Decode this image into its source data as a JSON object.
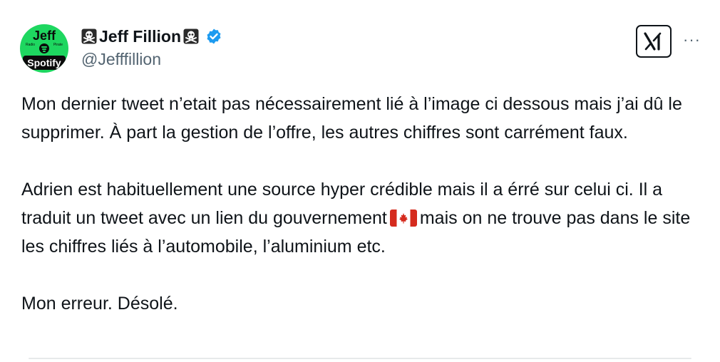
{
  "tweet": {
    "author": {
      "display_name": "Jeff Fillion",
      "handle": "@Jefffillion",
      "avatar": {
        "top_text": "Jeff",
        "small_left": "Radio",
        "small_right": "Pirate",
        "bottom_text": "Spotify"
      },
      "verified": true,
      "name_icons": [
        "skull-crossbones-icon",
        "skull-crossbones-icon"
      ]
    },
    "header": {
      "platform_logo": "x-logo-icon",
      "more_label": "···"
    },
    "text": {
      "paragraph1": "Mon dernier tweet n’etait pas nécessairement lié à l’image ci dessous mais j’ai dû le supprimer. À part la gestion de l’offre, les autres chiffres sont carrément faux.",
      "paragraph2_a": "Adrien est habituellement une source hyper crédible mais il a érré sur celui ci. Il a traduit un tweet avec un lien du gouvernement",
      "paragraph2_b": "mais on ne trouve pas dans le site les chiffres liés à l’automobile, l’aluminium etc.",
      "paragraph3": "Mon erreur. Désolé.",
      "flag_emoji": "canada-flag-icon"
    }
  },
  "colors": {
    "text": "#0f1419",
    "secondary": "#536471",
    "verified": "#1d9bf0",
    "avatar_bg": "#1ed760"
  }
}
